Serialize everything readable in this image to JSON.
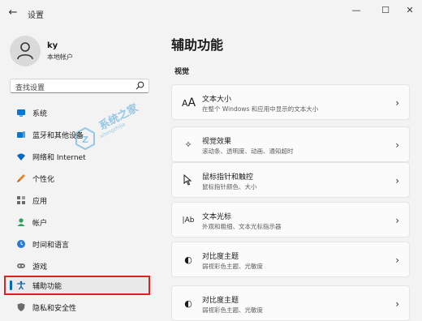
{
  "window": {
    "title": "设置"
  },
  "user": {
    "name": "ky",
    "account_type": "本地帐户"
  },
  "search": {
    "placeholder": "查找设置"
  },
  "watermark": {
    "text": "系统之家",
    "sub": "xitongzhijia"
  },
  "nav": [
    {
      "label": "系统",
      "icon": "monitor-icon",
      "color": "#0078d4"
    },
    {
      "label": "蓝牙和其他设备",
      "icon": "bluetooth-devices-icon",
      "color": "#0078d4"
    },
    {
      "label": "网络和 Internet",
      "icon": "wifi-icon",
      "color": "#0067c0"
    },
    {
      "label": "个性化",
      "icon": "brush-icon",
      "color": "#e3862b"
    },
    {
      "label": "应用",
      "icon": "apps-icon",
      "color": "#6b6b6b"
    },
    {
      "label": "帐户",
      "icon": "person-icon",
      "color": "#2aa05a"
    },
    {
      "label": "时间和语言",
      "icon": "globe-clock-icon",
      "color": "#2b7bd6"
    },
    {
      "label": "游戏",
      "icon": "game-controller-icon",
      "color": "#7a7a7a"
    },
    {
      "label": "辅助功能",
      "icon": "accessibility-icon",
      "color": "#0a5fb4"
    },
    {
      "label": "隐私和安全性",
      "icon": "shield-icon",
      "color": "#6b6b6b"
    }
  ],
  "active_nav": "辅助功能",
  "main": {
    "title": "辅助功能",
    "section": "视觉",
    "cards": [
      {
        "title": "文本大小",
        "subtitle": "在整个 Windows 和应用中显示的文本大小",
        "icon": "text-size-icon"
      },
      {
        "title": "视觉效果",
        "subtitle": "滚动条、透明度、动画、通知超时",
        "icon": "sparkle-icon"
      },
      {
        "title": "鼠标指针和触控",
        "subtitle": "鼠标指针颜色、大小",
        "icon": "mouse-pointer-icon"
      },
      {
        "title": "文本光标",
        "subtitle": "外观和粗细、文本光标指示器",
        "icon": "text-cursor-icon"
      },
      {
        "title": "对比度主题",
        "subtitle": "弱视彩色主题、光敏度",
        "icon": "contrast-icon"
      },
      {
        "title": "对比度主题",
        "subtitle": "弱视彩色主题、光敏度",
        "icon": "contrast-icon"
      }
    ]
  }
}
